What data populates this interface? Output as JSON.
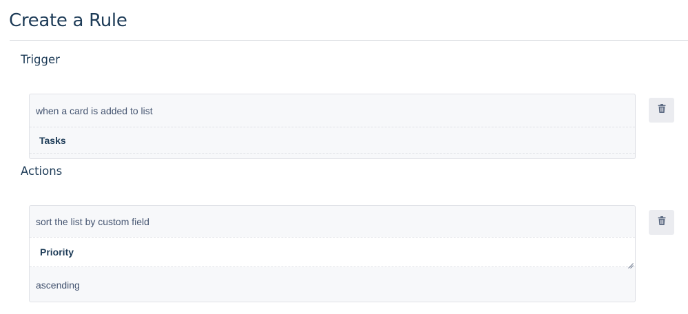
{
  "page": {
    "title": "Create a Rule"
  },
  "trigger": {
    "heading": "Trigger",
    "description": "when a card is added to list",
    "list_name": "Tasks",
    "delete_icon": "trash-icon"
  },
  "actions": {
    "heading": "Actions",
    "description": "sort the list by custom field",
    "field_name": "Priority",
    "order": "ascending",
    "delete_icon": "trash-icon"
  },
  "colors": {
    "title": "#1d3b57",
    "card_background": "#f7f8fa",
    "card_border": "#dfe1e6",
    "button_background": "#ebecf0",
    "icon": "#5e6c84"
  }
}
